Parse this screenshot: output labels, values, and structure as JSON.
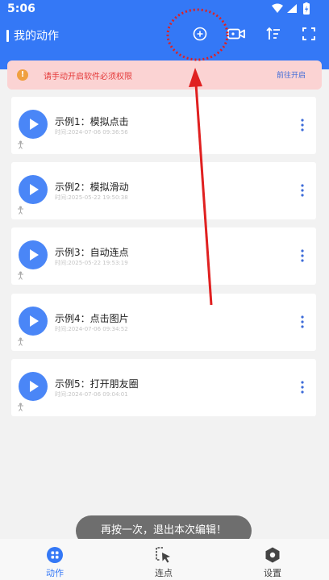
{
  "status_bar": {
    "time": "5:06"
  },
  "header": {
    "title": "我的动作"
  },
  "toolbar": {
    "icons": [
      "add-circle-icon",
      "video-record-icon",
      "sort-icon",
      "expand-icon"
    ]
  },
  "banner": {
    "text": "请手动开启软件必须权限",
    "link": "前往开启"
  },
  "actions": [
    {
      "title": "示例1：模拟点击",
      "time": "时间:2024-07-06 09:36:56"
    },
    {
      "title": "示例2：模拟滑动",
      "time": "时间:2025-05-22 19:50:38"
    },
    {
      "title": "示例3：自动连点",
      "time": "时间:2025-05-22 19:53:19"
    },
    {
      "title": "示例4：点击图片",
      "time": "时间:2024-07-06 09:34:52"
    },
    {
      "title": "示例5：打开朋友圈",
      "time": "时间:2024-07-06 09:04:01"
    }
  ],
  "toast": "再按一次，退出本次编辑！",
  "nav": [
    {
      "label": "动作",
      "icon": "grid-icon",
      "active": true
    },
    {
      "label": "连点",
      "icon": "cursor-click-icon",
      "active": false
    },
    {
      "label": "设置",
      "icon": "settings-icon",
      "active": false
    }
  ],
  "colors": {
    "primary": "#3478f6",
    "banner_bg": "#fbd3d3",
    "banner_text": "#e43a3a",
    "annotation": "#e02020"
  }
}
